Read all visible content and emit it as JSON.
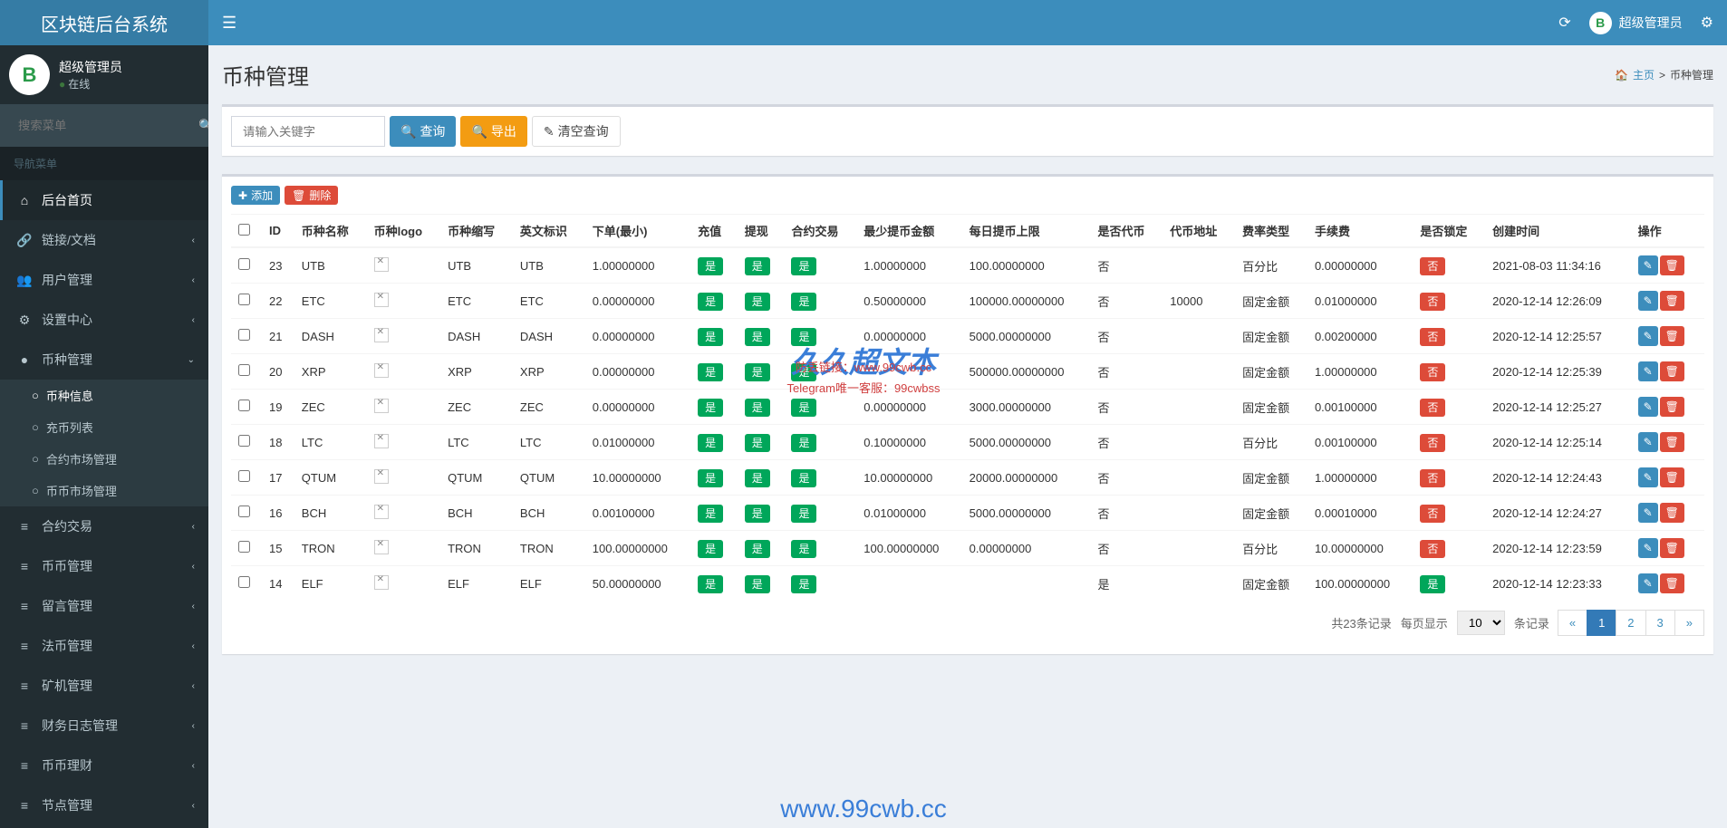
{
  "header": {
    "logo": "区块链后台系统",
    "user_name": "超级管理员"
  },
  "sidebar": {
    "user_name": "超级管理员",
    "user_status": "在线",
    "search_placeholder": "搜索菜单",
    "nav_header": "导航菜单",
    "items": [
      {
        "icon": "⌂",
        "label": "后台首页",
        "active": true
      },
      {
        "icon": "🔗",
        "label": "链接/文档",
        "chevron": true
      },
      {
        "icon": "👥",
        "label": "用户管理",
        "chevron": true
      },
      {
        "icon": "⚙",
        "label": "设置中心",
        "chevron": true
      },
      {
        "icon": "●",
        "label": "币种管理",
        "chevron": true,
        "expanded": true,
        "sub": [
          {
            "label": "币种信息",
            "active": true
          },
          {
            "label": "充币列表"
          },
          {
            "label": "合约市场管理"
          },
          {
            "label": "币币市场管理"
          }
        ]
      },
      {
        "icon": "≡",
        "label": "合约交易",
        "chevron": true
      },
      {
        "icon": "≡",
        "label": "币币管理",
        "chevron": true
      },
      {
        "icon": "≡",
        "label": "留言管理",
        "chevron": true
      },
      {
        "icon": "≡",
        "label": "法币管理",
        "chevron": true
      },
      {
        "icon": "≡",
        "label": "矿机管理",
        "chevron": true
      },
      {
        "icon": "≡",
        "label": "财务日志管理",
        "chevron": true
      },
      {
        "icon": "≡",
        "label": "币币理财",
        "chevron": true
      },
      {
        "icon": "≡",
        "label": "节点管理",
        "chevron": true
      }
    ]
  },
  "page": {
    "title": "币种管理",
    "breadcrumb_home": "主页",
    "breadcrumb_current": "币种管理"
  },
  "search": {
    "placeholder": "请输入关键字",
    "query_btn": "查询",
    "export_btn": "导出",
    "clear_btn": "清空查询"
  },
  "actions": {
    "add_btn": "添加",
    "delete_btn": "删除"
  },
  "table": {
    "headers": [
      "ID",
      "币种名称",
      "币种logo",
      "币种缩写",
      "英文标识",
      "下单(最小)",
      "充值",
      "提现",
      "合约交易",
      "最少提币金额",
      "每日提币上限",
      "是否代币",
      "代币地址",
      "费率类型",
      "手续费",
      "是否锁定",
      "创建时间",
      "操作"
    ],
    "rows": [
      {
        "id": "23",
        "name": "UTB",
        "abbr": "UTB",
        "eng": "UTB",
        "min_order": "1.00000000",
        "recharge": "是",
        "withdraw": "是",
        "contract": "是",
        "min_withdraw": "1.00000000",
        "daily_limit": "100.00000000",
        "is_token": "否",
        "token_addr": "",
        "fee_type": "百分比",
        "fee": "0.00000000",
        "locked": "否",
        "created": "2021-08-03 11:34:16"
      },
      {
        "id": "22",
        "name": "ETC",
        "abbr": "ETC",
        "eng": "ETC",
        "min_order": "0.00000000",
        "recharge": "是",
        "withdraw": "是",
        "contract": "是",
        "min_withdraw": "0.50000000",
        "daily_limit": "100000.00000000",
        "is_token": "否",
        "token_addr": "10000",
        "fee_type": "固定金额",
        "fee": "0.01000000",
        "locked": "否",
        "created": "2020-12-14 12:26:09"
      },
      {
        "id": "21",
        "name": "DASH",
        "abbr": "DASH",
        "eng": "DASH",
        "min_order": "0.00000000",
        "recharge": "是",
        "withdraw": "是",
        "contract": "是",
        "min_withdraw": "0.00000000",
        "daily_limit": "5000.00000000",
        "is_token": "否",
        "token_addr": "",
        "fee_type": "固定金额",
        "fee": "0.00200000",
        "locked": "否",
        "created": "2020-12-14 12:25:57"
      },
      {
        "id": "20",
        "name": "XRP",
        "abbr": "XRP",
        "eng": "XRP",
        "min_order": "0.00000000",
        "recharge": "是",
        "withdraw": "是",
        "contract": "是",
        "min_withdraw": "",
        "daily_limit": "500000.00000000",
        "is_token": "否",
        "token_addr": "",
        "fee_type": "固定金额",
        "fee": "1.00000000",
        "locked": "否",
        "created": "2020-12-14 12:25:39"
      },
      {
        "id": "19",
        "name": "ZEC",
        "abbr": "ZEC",
        "eng": "ZEC",
        "min_order": "0.00000000",
        "recharge": "是",
        "withdraw": "是",
        "contract": "是",
        "min_withdraw": "0.00000000",
        "daily_limit": "3000.00000000",
        "is_token": "否",
        "token_addr": "",
        "fee_type": "固定金额",
        "fee": "0.00100000",
        "locked": "否",
        "created": "2020-12-14 12:25:27"
      },
      {
        "id": "18",
        "name": "LTC",
        "abbr": "LTC",
        "eng": "LTC",
        "min_order": "0.01000000",
        "recharge": "是",
        "withdraw": "是",
        "contract": "是",
        "min_withdraw": "0.10000000",
        "daily_limit": "5000.00000000",
        "is_token": "否",
        "token_addr": "",
        "fee_type": "百分比",
        "fee": "0.00100000",
        "locked": "否",
        "created": "2020-12-14 12:25:14"
      },
      {
        "id": "17",
        "name": "QTUM",
        "abbr": "QTUM",
        "eng": "QTUM",
        "min_order": "10.00000000",
        "recharge": "是",
        "withdraw": "是",
        "contract": "是",
        "min_withdraw": "10.00000000",
        "daily_limit": "20000.00000000",
        "is_token": "否",
        "token_addr": "",
        "fee_type": "固定金额",
        "fee": "1.00000000",
        "locked": "否",
        "created": "2020-12-14 12:24:43"
      },
      {
        "id": "16",
        "name": "BCH",
        "abbr": "BCH",
        "eng": "BCH",
        "min_order": "0.00100000",
        "recharge": "是",
        "withdraw": "是",
        "contract": "是",
        "min_withdraw": "0.01000000",
        "daily_limit": "5000.00000000",
        "is_token": "否",
        "token_addr": "",
        "fee_type": "固定金额",
        "fee": "0.00010000",
        "locked": "否",
        "created": "2020-12-14 12:24:27"
      },
      {
        "id": "15",
        "name": "TRON",
        "abbr": "TRON",
        "eng": "TRON",
        "min_order": "100.00000000",
        "recharge": "是",
        "withdraw": "是",
        "contract": "是",
        "min_withdraw": "100.00000000",
        "daily_limit": "0.00000000",
        "is_token": "否",
        "token_addr": "",
        "fee_type": "百分比",
        "fee": "10.00000000",
        "locked": "否",
        "created": "2020-12-14 12:23:59"
      },
      {
        "id": "14",
        "name": "ELF",
        "abbr": "ELF",
        "eng": "ELF",
        "min_order": "50.00000000",
        "recharge": "是",
        "withdraw": "是",
        "contract": "是",
        "min_withdraw": "",
        "daily_limit": "",
        "is_token": "是",
        "token_addr": "",
        "fee_type": "固定金额",
        "fee": "100.00000000",
        "locked": "是",
        "locked_green": true,
        "created": "2020-12-14 12:23:33"
      }
    ]
  },
  "pagination": {
    "total_text": "共23条记录",
    "per_page_text": "每页显示",
    "per_page_value": "10",
    "records_text": "条记录",
    "pages": [
      "«",
      "1",
      "2",
      "3",
      "»"
    ],
    "active_page": "1"
  },
  "watermarks": {
    "main": "久久超文本",
    "url1": "www.99cwb.cc",
    "small1": "防丢链接：www.99cwb.cc",
    "small2": "Telegram唯一客服：99cwbss"
  }
}
